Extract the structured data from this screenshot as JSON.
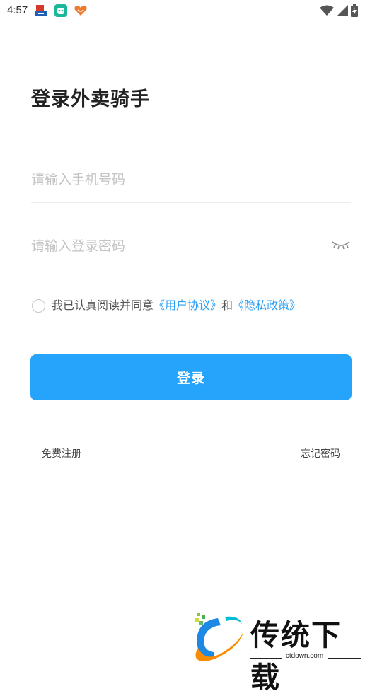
{
  "status_bar": {
    "time": "4:57",
    "notification_icons": [
      "store-app-icon",
      "robot-app-icon",
      "heart-app-icon"
    ],
    "system_icons": [
      "wifi-icon",
      "cellular-signal-icon",
      "battery-charging-icon"
    ]
  },
  "login": {
    "title": "登录外卖骑手",
    "phone_placeholder": "请输入手机号码",
    "password_placeholder": "请输入登录密码",
    "agreement": {
      "prefix": "我已认真阅读并同意",
      "user_agreement": "《用户协议》",
      "conjunction": "和",
      "privacy_policy": "《隐私政策》"
    },
    "login_button": "登录",
    "register_link": "免费注册",
    "forgot_password_link": "忘记密码"
  },
  "watermark": {
    "brand": "传统下载",
    "url": "ctdown.com"
  },
  "colors": {
    "accent": "#26a3fb",
    "link": "#2ba0f7",
    "placeholder": "#c3c3c3"
  }
}
